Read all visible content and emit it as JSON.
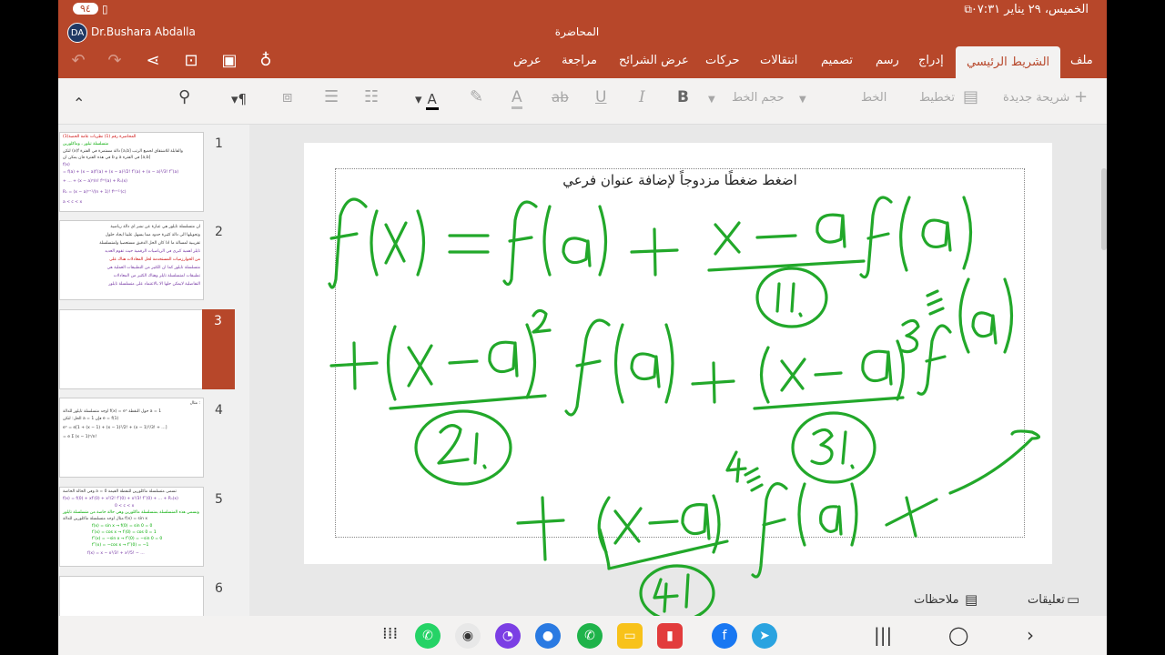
{
  "status_bar": {
    "time": "الخميس، ٢٩ يناير ٠٧:٣١",
    "battery": "٩٤"
  },
  "title_bar": {
    "user_initials": "DA",
    "user_name": "Dr.Bushara Abdalla",
    "document_title": "المحاضرة"
  },
  "tabs": [
    "ملف",
    "الشريط الرئيسي",
    "إدراج",
    "رسم",
    "تصميم",
    "انتقالات",
    "حركات",
    "عرض الشرائح",
    "مراجعة",
    "عرض"
  ],
  "active_tab": "الشريط الرئيسي",
  "ribbon": {
    "new_slide": "شريحة جديدة",
    "layout": "تخطيط",
    "font": "الخط",
    "font_size": "حجم الخط",
    "bold": "B",
    "italic": "I",
    "underline": "U",
    "strike": "ab",
    "font_color_glyph": "A",
    "highlight_glyph": "A"
  },
  "thumbnails": {
    "numbers": [
      "1",
      "2",
      "3",
      "4",
      "5",
      "6"
    ],
    "selected": "3",
    "slide1_lines": [
      "المحاضرة رقم (1)   نظريات عامة   الحصة(1)",
      "متسلسلة تيلور ، وماكلورين",
      "لتكن (x)f دالة مستمرة في الفترة [a,b] والقابلة للاشتقاق لجميع الرتب",
      "في هذه الفترة فان يمكن ان  b و a في الفترة [a,b]",
      "f(x)",
      "= f(a) + (x − a)f′(a) + (x − a)²/2! f″(a) + (x − a)³/3! f‴(a)",
      "+ … + (x − a)ⁿ/n! f⁽ⁿ⁾(a) + Rₙ(x)",
      "Rₙ = (x − a)ⁿ⁺¹/(n + 1)! f⁽ⁿ⁺¹⁾(c)",
      "a < c < x"
    ],
    "slide2_lines": [
      "ان متسلسلة تايلور هي عبارة عن نشر اي دالة رياضية",
      "وتحويلها الى دالة كثيرة حدود مما يسهل علينا ايجاد حلول",
      "تقريبية لمسالة ما اذا كان الحل الدقيق مستعصيا ولمتسلسلة",
      "تايلر اهمية كبرى في الرياضيات الرقمية حيث تقوم العديد",
      "من الخوارزميات المستخدمة لحل المعادلات هناك على",
      "متسلسلة تايلور كما ان الكثير من التطبيقات العملية هي",
      "تطبيقات لمتسلسلة تايلر وهناك الكثير من المعادلات",
      "التفاضلية لايمكن حلها الا بالاعتماد على متسلسلة تايلور"
    ],
    "slide4_lines": [
      "مثال :",
      "اوجد متسلسلة تايلور للدالة f(x) = eˣ حول النقطة a = 1",
      "الحل: لتكن a = 1 فإن      e = f(1)",
      "eˣ = e[1 + (x − 1) + (x − 1)²/2! + (x − 1)³/3! + …]",
      "= e Σ (x − 1)ⁿ/n!"
    ],
    "slide5_lines": [
      "وفي الحالة الخاصة a = 0 تسمى متسلسلة ماكلورين للنقطة القيمة",
      "f(x) = f(0) + xf′(0) + x²/2! f″(0) + x³/3! f‴(0) + … + Rₙ(x)",
      "0 < c < x",
      "ونسمي هذه المتسلسلة بمتسلسلة ماكلورين وهي حالة خاصة من متسلسلة تايلور",
      "مثال اوجد متسلسلة ماكلورين للدالة f(x) = sin x",
      "f(x) = sin x → f(0) = sin 0 = 0",
      "f′(x) = cos x → f′(0) = cos 0 = 1",
      "f″(x) = −sin x → f″(0) = −sin 0 = 0",
      "f‴(x) = −cos x → f‴(0) = −1",
      "f(x) = x − x³/3! + x⁵/5! − …"
    ]
  },
  "slide": {
    "subtitle_placeholder": "اضغط ضغطًا مزدوجاً لإضافة عنوان فرعي",
    "ink_color": "#22a82a"
  },
  "bottom_bar": {
    "comments": "تعليقات",
    "notes": "ملاحظات"
  },
  "colors": {
    "accent": "#b7472a",
    "ribbon_bg": "#f3f2f1"
  }
}
